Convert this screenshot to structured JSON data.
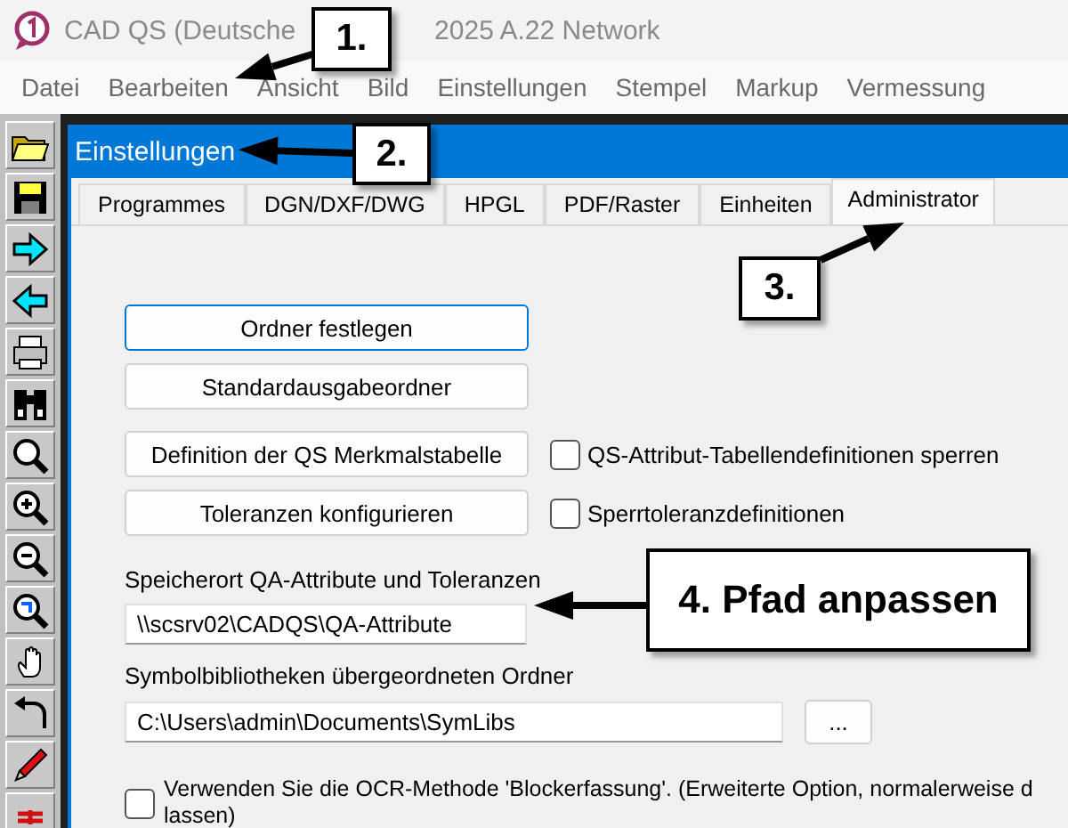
{
  "window": {
    "title_parts": [
      "CAD QS (Deutsche",
      "2025 A.22 Network"
    ]
  },
  "menu": [
    "Datei",
    "Bearbeiten",
    "Ansicht",
    "Bild",
    "Einstellungen",
    "Stempel",
    "Markup",
    "Vermessung"
  ],
  "dialog": {
    "title": "Einstellungen",
    "tabs": [
      {
        "label": "Programmes",
        "selected": false
      },
      {
        "label": "DGN/DXF/DWG",
        "selected": false
      },
      {
        "label": "HPGL",
        "selected": false
      },
      {
        "label": "PDF/Raster",
        "selected": false
      },
      {
        "label": "Einheiten",
        "selected": false
      },
      {
        "label": "Administrator",
        "selected": true
      }
    ],
    "buttons": [
      {
        "label": "Ordner festlegen",
        "focused": true
      },
      {
        "label": "Standardausgabeordner",
        "focused": false
      },
      {
        "label": "Definition der QS Merkmalstabelle",
        "focused": false,
        "checkbox": {
          "label": "QS-Attribut-Tabellendefinitionen sperren",
          "checked": false
        }
      },
      {
        "label": "Toleranzen konfigurieren",
        "focused": false,
        "checkbox": {
          "label": "Sperrtoleranzdefinitionen",
          "checked": false
        }
      }
    ],
    "fields": [
      {
        "label": "Speicherort QA-Attribute und Toleranzen",
        "value": "\\\\scsrv02\\CADQS\\QA-Attribute"
      },
      {
        "label": "Symbolbibliotheken übergeordneten Ordner",
        "value": "C:\\Users\\admin\\Documents\\SymLibs",
        "browse": "..."
      }
    ],
    "ocr_option": {
      "checked": false,
      "lines": [
        "Verwenden Sie die OCR-Methode 'Blockerfassung'. (Erweiterte Option, normalerweise d",
        "lassen)"
      ]
    }
  },
  "annotations": [
    {
      "text": "1."
    },
    {
      "text": "2."
    },
    {
      "text": "3."
    },
    {
      "text": "4. Pfad anpassen"
    }
  ]
}
